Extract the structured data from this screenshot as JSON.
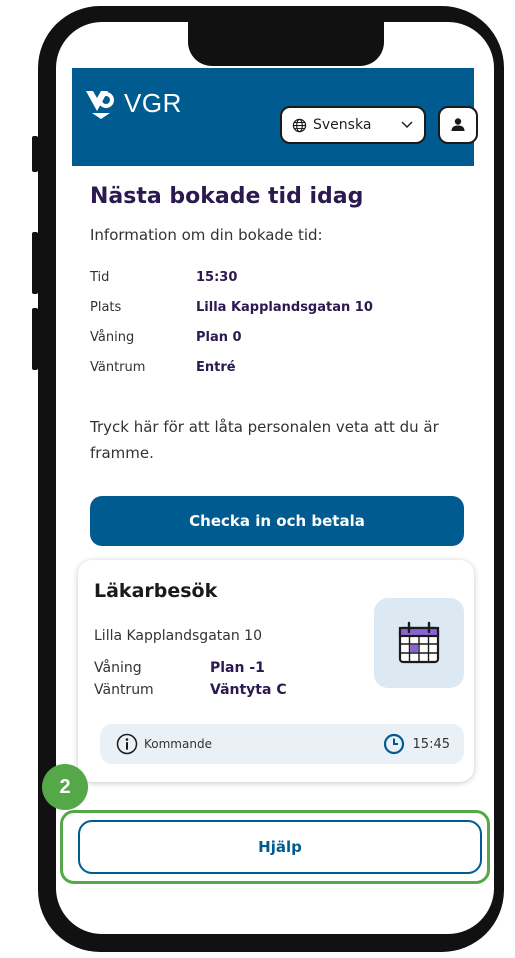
{
  "header": {
    "logo_text": "VGR",
    "language": "Svenska",
    "brand_color": "#005b91"
  },
  "main": {
    "title": "Nästa bokade tid idag",
    "intro": "Information om din bokade tid:",
    "details": [
      {
        "label": "Tid",
        "value": "15:30"
      },
      {
        "label": "Plats",
        "value": "Lilla Kapplandsgatan 10"
      },
      {
        "label": "Våning",
        "value": "Plan 0"
      },
      {
        "label": "Väntrum",
        "value": "Entré"
      }
    ],
    "prompt": "Tryck här för att låta personalen veta att du är framme.",
    "checkin_label": "Checka in och betala"
  },
  "card": {
    "title": "Läkarbesök",
    "address": "Lilla Kapplandsgatan 10",
    "rows": [
      {
        "label": "Våning",
        "value": "Plan -1"
      },
      {
        "label": "Väntrum",
        "value": "Väntyta C"
      }
    ],
    "status": "Kommande",
    "time": "15:45",
    "icon": "calendar-icon"
  },
  "step_badge": "2",
  "help_label": "Hjälp",
  "colors": {
    "accent": "#005b91",
    "highlight": "#54a848",
    "title": "#2b1950"
  }
}
